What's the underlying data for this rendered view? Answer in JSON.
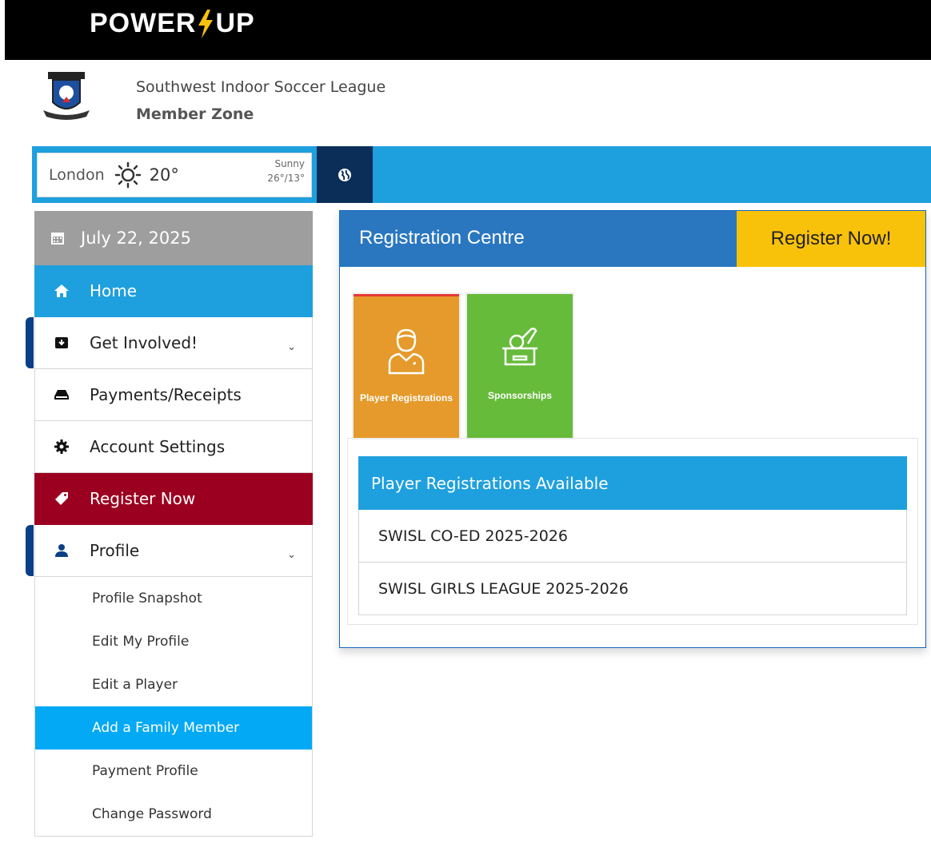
{
  "brand": {
    "left": "POWER",
    "right": "UP"
  },
  "header": {
    "org_name": "Southwest Indoor Soccer League",
    "zone": "Member Zone"
  },
  "weather": {
    "city": "London",
    "temp": "20°",
    "condition": "Sunny",
    "range": "26°/13°"
  },
  "sidebar": {
    "date": "July 22, 2025",
    "items": [
      {
        "label": "Home",
        "icon": "home-icon"
      },
      {
        "label": "Get Involved!",
        "icon": "inbox-icon"
      },
      {
        "label": "Payments/Receipts",
        "icon": "tray-icon"
      },
      {
        "label": "Account Settings",
        "icon": "gear-icon"
      },
      {
        "label": "Register Now",
        "icon": "tag-icon"
      },
      {
        "label": "Profile",
        "icon": "user-icon"
      }
    ],
    "profile_sub": [
      "Profile Snapshot",
      "Edit My Profile",
      "Edit a Player",
      "Add a Family Member",
      "Payment Profile",
      "Change Password"
    ]
  },
  "panel": {
    "title": "Registration Centre",
    "register_button": "Register Now!",
    "tiles": [
      "Player Registrations",
      "Sponsorships"
    ],
    "available_heading": "Player Registrations Available",
    "available": [
      "SWISL CO-ED 2025-2026",
      "SWISL GIRLS LEAGUE 2025-2026"
    ]
  },
  "colors": {
    "accent_blue": "#1fa0de",
    "register_red": "#9c0020",
    "yellow": "#f9c20a"
  }
}
